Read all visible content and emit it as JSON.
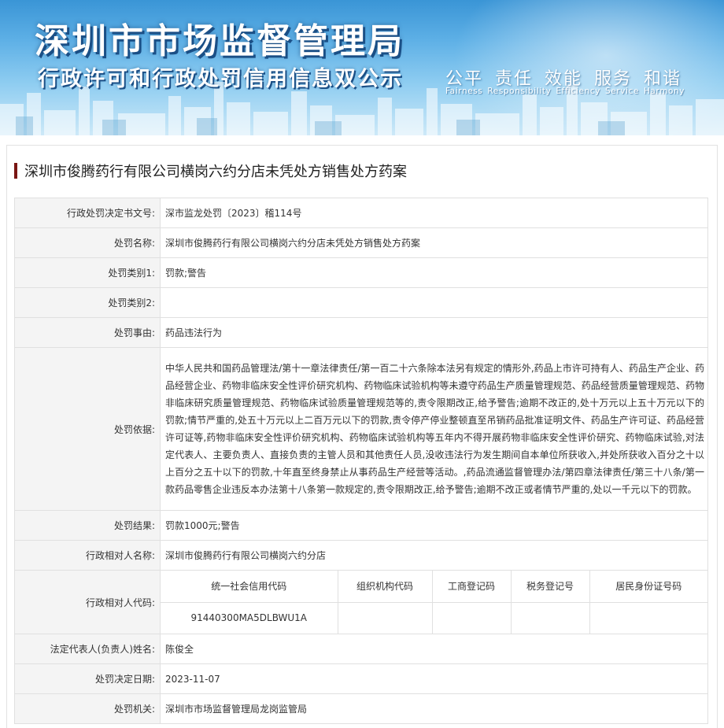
{
  "banner": {
    "title": "深圳市市场监督管理局",
    "subtitle": "行政许可和行政处罚信用信息双公示",
    "slogan_cn": "公平 责任 效能 服务 和谐",
    "slogan_en": "Fairness Responsibility Efficiency Service Harmony"
  },
  "case_title": "深圳市俊腾药行有限公司横岗六约分店未凭处方销售处方药案",
  "fields": {
    "decision_no": {
      "label": "行政处罚决定书文号:",
      "value": "深市监龙处罚〔2023〕稽114号"
    },
    "penalty_name": {
      "label": "处罚名称:",
      "value": "深圳市俊腾药行有限公司横岗六约分店未凭处方销售处方药案"
    },
    "category1": {
      "label": "处罚类别1:",
      "value": "罚款;警告"
    },
    "category2": {
      "label": "处罚类别2:",
      "value": ""
    },
    "reason": {
      "label": "处罚事由:",
      "value": "药品违法行为"
    },
    "basis": {
      "label": "处罚依据:",
      "value": "中华人民共和国药品管理法/第十一章法律责任/第一百二十六条除本法另有规定的情形外,药品上市许可持有人、药品生产企业、药品经营企业、药物非临床安全性评价研究机构、药物临床试验机构等未遵守药品生产质量管理规范、药品经营质量管理规范、药物非临床研究质量管理规范、药物临床试验质量管理规范等的,责令限期改正,给予警告;逾期不改正的,处十万元以上五十万元以下的罚款;情节严重的,处五十万元以上二百万元以下的罚款,责令停产停业整顿直至吊销药品批准证明文件、药品生产许可证、药品经营许可证等,药物非临床安全性评价研究机构、药物临床试验机构等五年内不得开展药物非临床安全性评价研究、药物临床试验,对法定代表人、主要负责人、直接负责的主管人员和其他责任人员,没收违法行为发生期间自本单位所获收入,并处所获收入百分之十以上百分之五十以下的罚款,十年直至终身禁止从事药品生产经营等活动。,药品流通监督管理办法/第四章法律责任/第三十八条/第一款药品零售企业违反本办法第十八条第一款规定的,责令限期改正,给予警告;逾期不改正或者情节严重的,处以一千元以下的罚款。"
    },
    "result": {
      "label": "处罚结果:",
      "value": "罚款1000元;警告"
    },
    "counterpart_name": {
      "label": "行政相对人名称:",
      "value": "深圳市俊腾药行有限公司横岗六约分店"
    },
    "counterpart_code": {
      "label": "行政相对人代码:",
      "headers": [
        "统一社会信用代码",
        "组织机构代码",
        "工商登记码",
        "税务登记号",
        "居民身份证号码"
      ],
      "values": [
        "91440300MA5DLBWU1A",
        "",
        "",
        "",
        ""
      ]
    },
    "legal_rep": {
      "label": "法定代表人(负责人)姓名:",
      "value": "陈俊全"
    },
    "decision_date": {
      "label": "处罚决定日期:",
      "value": "2023-11-07"
    },
    "authority": {
      "label": "处罚机关:",
      "value": "深圳市市场监督管理局龙岗监管局"
    }
  },
  "colors": {
    "heading_bar": "#7a1613",
    "label_bg": "#f4f4f4",
    "border": "#e0e0e0",
    "banner_blue": "#3a95d6"
  }
}
